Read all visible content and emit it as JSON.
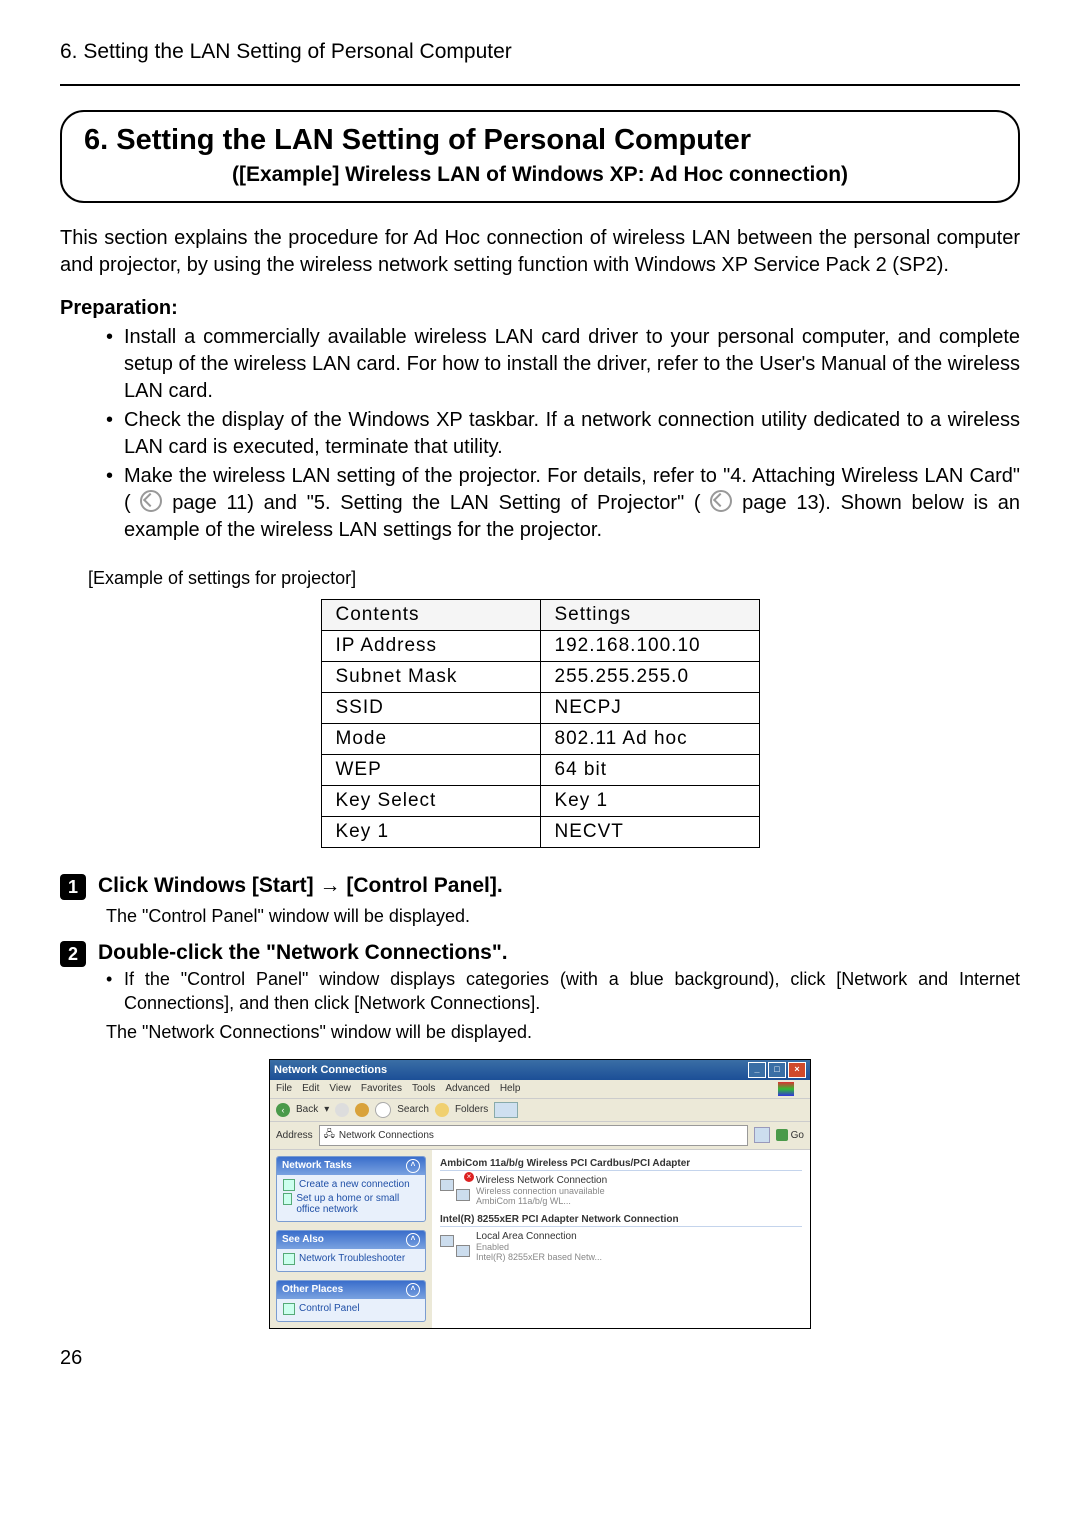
{
  "runningHeader": "6. Setting the LAN Setting of Personal Computer",
  "titleBox": {
    "main": "6. Setting the LAN Setting of Personal Computer",
    "sub": "([Example] Wireless LAN of Windows XP: Ad Hoc connection)"
  },
  "intro": "This section explains the procedure for Ad Hoc connection of wireless LAN between the personal computer and projector, by using the wireless network setting function with Windows XP Service Pack 2 (SP2).",
  "preparation": {
    "heading": "Preparation:",
    "items": [
      "Install a commercially available wireless LAN card driver to your personal computer, and complete setup of the wireless LAN card.  For how to install the driver, refer to the User's Manual of the wireless LAN card.",
      "Check the display of the Windows XP taskbar.  If a network connection utility dedicated to a wireless LAN card is executed, terminate that utility."
    ],
    "item3_a": "Make the wireless LAN setting of the projector. For details, refer to \"4. Attaching Wireless LAN Card\" (",
    "item3_p1": " page 11) and \"5. Setting the LAN Setting of Projector\" (",
    "item3_p2": " page 13). Shown below is an example of the wireless LAN settings for the projector."
  },
  "exampleCaption": "[Example of settings for projector]",
  "settingsTable": {
    "headers": [
      "Contents",
      "Settings"
    ],
    "rows": [
      [
        "IP Address",
        "192.168.100.10"
      ],
      [
        "Subnet Mask",
        "255.255.255.0"
      ],
      [
        "SSID",
        "NECPJ"
      ],
      [
        "Mode",
        "802.11 Ad hoc"
      ],
      [
        "WEP",
        "64 bit"
      ],
      [
        "Key Select",
        "Key 1"
      ],
      [
        "Key 1",
        "NECVT"
      ]
    ]
  },
  "steps": {
    "s1": {
      "num": "1",
      "title": "Click Windows [Start] → [Control Panel].",
      "body": "The \"Control Panel\" window will be displayed."
    },
    "s2": {
      "num": "2",
      "title": "Double-click the \"Network Connections\".",
      "bullet": "If the \"Control Panel\" window displays categories (with a blue background), click [Network and Internet Connections], and then click [Network Connections].",
      "body": "The \"Network Connections\" window will be displayed."
    }
  },
  "xp": {
    "title": "Network Connections",
    "menu": {
      "file": "File",
      "edit": "Edit",
      "view": "View",
      "favorites": "Favorites",
      "tools": "Tools",
      "advanced": "Advanced",
      "help": "Help"
    },
    "toolbar": {
      "back": "Back",
      "search": "Search",
      "folders": "Folders"
    },
    "address": {
      "label": "Address",
      "value": "Network Connections",
      "go": "Go"
    },
    "side": {
      "p1": {
        "title": "Network Tasks",
        "i1": "Create a new connection",
        "i2": "Set up a home or small office network"
      },
      "p2": {
        "title": "See Also",
        "i1": "Network Troubleshooter"
      },
      "p3": {
        "title": "Other Places",
        "i1": "Control Panel"
      }
    },
    "main": {
      "g1": "AmbiCom 11a/b/g Wireless PCI Cardbus/PCI Adapter",
      "c1": {
        "name": "Wireless Network Connection",
        "status": "Wireless connection unavailable",
        "detail": "AmbiCom 11a/b/g WL..."
      },
      "g2": "Intel(R) 8255xER PCI Adapter Network Connection",
      "c2": {
        "name": "Local Area Connection",
        "status": "Enabled",
        "detail": "Intel(R) 8255xER based Netw..."
      }
    }
  },
  "pageNumber": "26"
}
